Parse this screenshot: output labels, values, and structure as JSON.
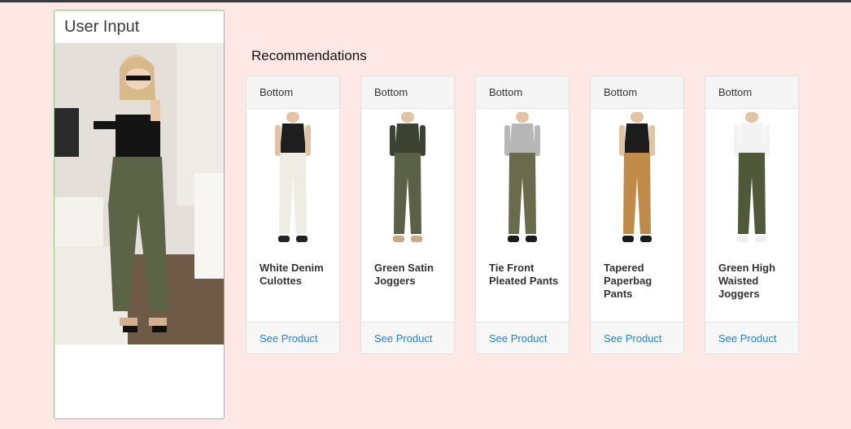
{
  "input_panel": {
    "title": "User Input"
  },
  "recommendations": {
    "title": "Recommendations",
    "items": [
      {
        "category": "Bottom",
        "name": "White Denim Culottes",
        "link": "See Product",
        "top": "#1e1e1e",
        "pants": "#efece4",
        "shoes": "#222222"
      },
      {
        "category": "Bottom",
        "name": "Green Satin Joggers",
        "link": "See Product",
        "top": "#3c4230",
        "pants": "#5a6146",
        "shoes": "#c9a98a"
      },
      {
        "category": "Bottom",
        "name": "Tie Front Pleated Pants",
        "link": "See Product",
        "top": "#b7b7b7",
        "pants": "#6a6b4c",
        "shoes": "#1a1a1a"
      },
      {
        "category": "Bottom",
        "name": "Tapered Paperbag Pants",
        "link": "See Product",
        "top": "#1c1c1c",
        "pants": "#c08a48",
        "shoes": "#1a1a1a"
      },
      {
        "category": "Bottom",
        "name": "Green High Waisted Joggers",
        "link": "See Product",
        "top": "#f3f3f3",
        "pants": "#4f5838",
        "shoes": "#eeeeee"
      }
    ]
  }
}
